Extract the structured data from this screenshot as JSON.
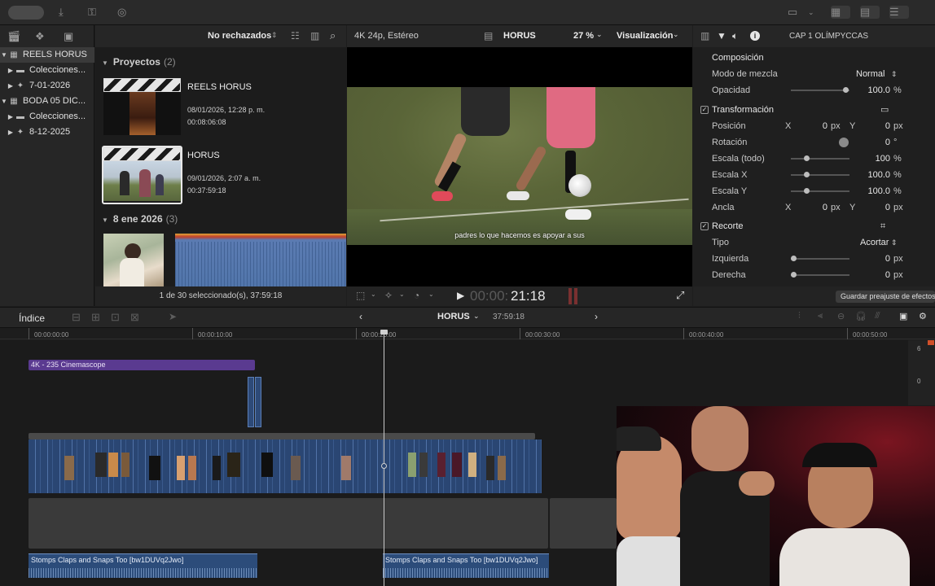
{
  "toolbar": {
    "icons": [
      "download-icon",
      "key-icon",
      "check-circle-icon",
      "window-icon",
      "grid-icon",
      "list-icon",
      "sliders-icon"
    ]
  },
  "library": {
    "items": [
      {
        "label": "REELS HORUS",
        "level": 0,
        "expanded": true,
        "selected": true,
        "icon": "library-icon"
      },
      {
        "label": "Colecciones...",
        "level": 1,
        "expanded": false,
        "icon": "folder-icon"
      },
      {
        "label": "7-01-2026",
        "level": 1,
        "expanded": false,
        "icon": "star-icon"
      },
      {
        "label": "BODA 05 DIC...",
        "level": 0,
        "expanded": true,
        "icon": "library-icon"
      },
      {
        "label": "Colecciones...",
        "level": 1,
        "expanded": false,
        "icon": "folder-icon"
      },
      {
        "label": "8-12-2025",
        "level": 1,
        "expanded": false,
        "icon": "star-icon"
      }
    ]
  },
  "browser": {
    "filter": "No rechazados",
    "section1": {
      "title": "Proyectos",
      "count": "(2)"
    },
    "projects": [
      {
        "name": "REELS HORUS",
        "date": "08/01/2026, 12:28 p. m.",
        "duration": "00:08:06:08"
      },
      {
        "name": "HORUS",
        "date": "09/01/2026, 2:07 a. m.",
        "duration": "00:37:59:18"
      }
    ],
    "section2": {
      "title": "8 ene 2026",
      "count": "(3)"
    },
    "footer": "1 de 30 seleccionado(s), 37:59:18"
  },
  "viewer": {
    "format": "4K 24p, Estéreo",
    "project": "HORUS",
    "zoom": "27 %",
    "view_menu": "Visualización",
    "subtitle": "padres lo que hacemos es apoyar a sus",
    "timecode_dim": "00:00:",
    "timecode": "21:18"
  },
  "inspector": {
    "title": "CAP 1 OLÍMPYCCAS",
    "composicion": "Composición",
    "modo_label": "Modo de mezcla",
    "modo_value": "Normal",
    "opacidad_label": "Opacidad",
    "opacidad_value": "100.0",
    "transform": "Transformación",
    "posicion_label": "Posición",
    "pos_x": "0",
    "pos_y": "0",
    "rotacion_label": "Rotación",
    "rotacion_value": "0",
    "escala_todo_label": "Escala (todo)",
    "escala_todo_value": "100",
    "escala_x_label": "Escala X",
    "escala_x_value": "100.0",
    "escala_y_label": "Escala Y",
    "escala_y_value": "100.0",
    "ancla_label": "Ancla",
    "ancla_x": "0",
    "ancla_y": "0",
    "recorte": "Recorte",
    "tipo_label": "Tipo",
    "tipo_value": "Acortar",
    "izquierda_label": "Izquierda",
    "izquierda_value": "0",
    "derecha_label": "Derecha",
    "derecha_value": "0",
    "units": {
      "px": "px",
      "pct": "%",
      "deg": "°",
      "x": "X",
      "y": "Y"
    },
    "save_preset": "Guardar preajuste de efectos"
  },
  "timeline": {
    "index_label": "Índice",
    "project": "HORUS",
    "duration": "37:59:18",
    "ruler": [
      "00:00:00:00",
      "00:00:10:00",
      "00:00:20:00",
      "00:00:30:00",
      "00:00:40:00",
      "00:00:50:00"
    ],
    "meter": [
      "6",
      "0"
    ],
    "title_clip": "4K - 235 Cinemascope",
    "audio_clip": "Stomps Claps and Snaps Too [bw1DUVq2Jwo]"
  }
}
